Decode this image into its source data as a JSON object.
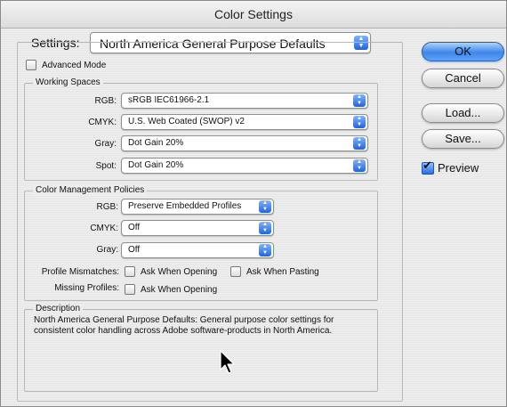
{
  "window": {
    "title": "Color Settings"
  },
  "settings": {
    "label": "Settings:",
    "value": "North America General Purpose Defaults",
    "advanced_mode": {
      "label": "Advanced Mode",
      "checked": false
    }
  },
  "working_spaces": {
    "title": "Working Spaces",
    "rgb": {
      "label": "RGB:",
      "value": "sRGB IEC61966-2.1"
    },
    "cmyk": {
      "label": "CMYK:",
      "value": "U.S. Web Coated (SWOP) v2"
    },
    "gray": {
      "label": "Gray:",
      "value": "Dot Gain 20%"
    },
    "spot": {
      "label": "Spot:",
      "value": "Dot Gain 20%"
    }
  },
  "policies": {
    "title": "Color Management Policies",
    "rgb": {
      "label": "RGB:",
      "value": "Preserve Embedded Profiles"
    },
    "cmyk": {
      "label": "CMYK:",
      "value": "Off"
    },
    "gray": {
      "label": "Gray:",
      "value": "Off"
    },
    "profile_mismatches": {
      "label": "Profile Mismatches:",
      "ask_opening": {
        "label": "Ask When Opening",
        "checked": false
      },
      "ask_pasting": {
        "label": "Ask When Pasting",
        "checked": false
      }
    },
    "missing_profiles": {
      "label": "Missing Profiles:",
      "ask_opening": {
        "label": "Ask When Opening",
        "checked": false
      }
    }
  },
  "description": {
    "title": "Description",
    "line1": "North America General Purpose Defaults:  General purpose color settings for",
    "line2": "consistent color handling across Adobe software-products in North America."
  },
  "buttons": {
    "ok": "OK",
    "cancel": "Cancel",
    "load": "Load...",
    "save": "Save..."
  },
  "preview": {
    "label": "Preview",
    "checked": true
  },
  "colors": {
    "default_button": "#3e86ea",
    "popup_arrows": "#2464d8"
  }
}
